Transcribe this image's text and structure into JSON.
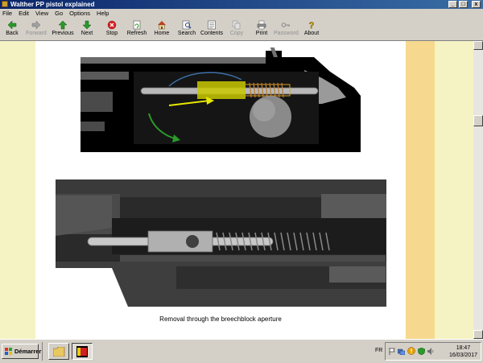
{
  "window": {
    "title": "Walther PP pistol explained"
  },
  "menu": [
    "File",
    "Edit",
    "View",
    "Go",
    "Options",
    "Help"
  ],
  "toolbar": [
    {
      "label": "Back",
      "icon": "back-arrow-icon",
      "disabled": false
    },
    {
      "label": "Forward",
      "icon": "forward-arrow-icon",
      "disabled": true
    },
    {
      "label": "Previous",
      "icon": "up-arrow-icon",
      "disabled": false
    },
    {
      "label": "Next",
      "icon": "down-arrow-icon",
      "disabled": false
    },
    {
      "label": "Stop",
      "icon": "stop-icon",
      "disabled": false
    },
    {
      "label": "Refresh",
      "icon": "refresh-icon",
      "disabled": false
    },
    {
      "label": "Home",
      "icon": "home-icon",
      "disabled": false
    },
    {
      "label": "Search",
      "icon": "search-icon",
      "disabled": false
    },
    {
      "label": "Contents",
      "icon": "contents-icon",
      "disabled": false
    },
    {
      "label": "Copy",
      "icon": "copy-icon",
      "disabled": true
    },
    {
      "label": "Print",
      "icon": "print-icon",
      "disabled": false
    },
    {
      "label": "Password",
      "icon": "key-icon",
      "disabled": true
    },
    {
      "label": "About",
      "icon": "question-icon",
      "disabled": false
    }
  ],
  "content": {
    "caption": "Removal through the breechblock aperture"
  },
  "taskbar": {
    "start_label": "Démarrer",
    "language": "FR",
    "time": "18:47",
    "date": "16/03/2017"
  }
}
